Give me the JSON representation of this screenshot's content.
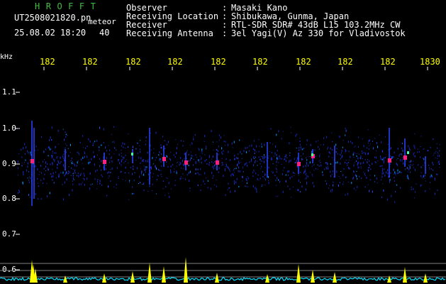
{
  "title": "HROFFT",
  "file_name": "UT2508021820.pn",
  "subtitle": "meteor",
  "date_time": "25.08.02 18:20",
  "number": "40",
  "header": {
    "rows": [
      {
        "label": "Observer",
        "value": "Masaki Kano"
      },
      {
        "label": "Receiving Location",
        "value": "Shibukawa, Gunma, Japan"
      },
      {
        "label": "Receiver",
        "value": "RTL-SDR SDR# 43dB L15 103.2MHz CW"
      },
      {
        "label": "Receiving Antenna",
        "value": "3el Yagi(V) Az 330 for Vladivostok"
      }
    ],
    "colon": ":"
  },
  "axes": {
    "y_unit": "kHz",
    "y_ticks": [
      "1.1",
      "1.0",
      "0.9",
      "0.8",
      "0.7",
      "0.6"
    ],
    "x_ticks": [
      "182",
      "182",
      "182",
      "182",
      "182",
      "182",
      "182",
      "182",
      "182",
      "1830"
    ]
  },
  "colors": {
    "background": "#000000",
    "title_green": "#3fbf3f",
    "tick_yellow": "#ffff00",
    "spectrogram_blue": "#1a2cc8",
    "signal_magenta": "#ff2080",
    "baseline_cyan": "#00e0ff",
    "spike_yellow": "#ffff00"
  }
}
